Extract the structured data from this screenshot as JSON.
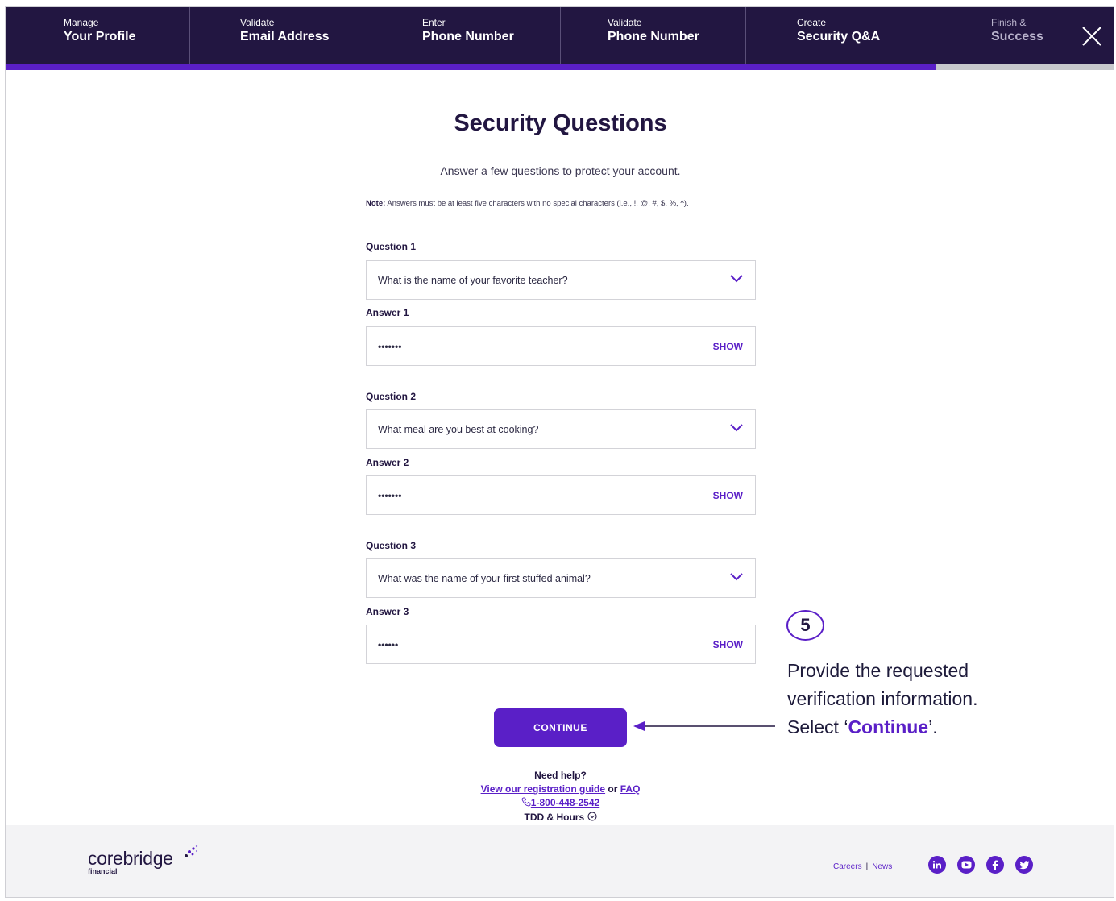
{
  "stepper": {
    "steps": [
      {
        "top": "Manage",
        "bottom": "Your Profile"
      },
      {
        "top": "Validate",
        "bottom": "Email Address"
      },
      {
        "top": "Enter",
        "bottom": "Phone Number"
      },
      {
        "top": "Validate",
        "bottom": "Phone Number"
      },
      {
        "top": "Create",
        "bottom": "Security Q&A"
      },
      {
        "top": "Finish &",
        "bottom": "Success"
      }
    ],
    "progress_fraction": 0.838
  },
  "form": {
    "title": "Security Questions",
    "subtitle": "Answer a few questions to protect your account.",
    "note_label": "Note:",
    "note_text": " Answers must be at least five characters with no special characters (i.e., !, @, #, $, %, ^).",
    "question1_label": "Question 1",
    "question1_value": "What is the name of your favorite teacher?",
    "answer1_label": "Answer 1",
    "answer1_value": "•••••••",
    "question2_label": "Question 2",
    "question2_value": "What meal are you best at cooking?",
    "answer2_label": "Answer 2",
    "answer2_value": "•••••••",
    "question3_label": "Question 3",
    "question3_value": "What was the name of your first stuffed animal?",
    "answer3_label": "Answer 3",
    "answer3_value": "••••••",
    "show_label": "SHOW",
    "continue_label": "CONTINUE"
  },
  "help": {
    "heading": "Need help?",
    "guide_link": "View our registration guide",
    "or": " or ",
    "faq_link": "FAQ",
    "phone": "1-800-448-2542",
    "tdd": "TDD & Hours"
  },
  "callout": {
    "number": "5",
    "line1": "Provide the requested",
    "line2": "verification information.",
    "line3_pre": "Select ‘",
    "line3_hl": "Continue",
    "line3_post": "’."
  },
  "footer": {
    "logo_word": "corebridge",
    "logo_sub": "financial",
    "careers": "Careers",
    "separator": "|",
    "news": "News",
    "social_icons": [
      "linkedin-icon",
      "youtube-icon",
      "facebook-icon",
      "twitter-icon"
    ]
  },
  "colors": {
    "header_bg": "#221641",
    "accent": "#5a1fc7",
    "footer_bg": "#f3f3f5"
  }
}
